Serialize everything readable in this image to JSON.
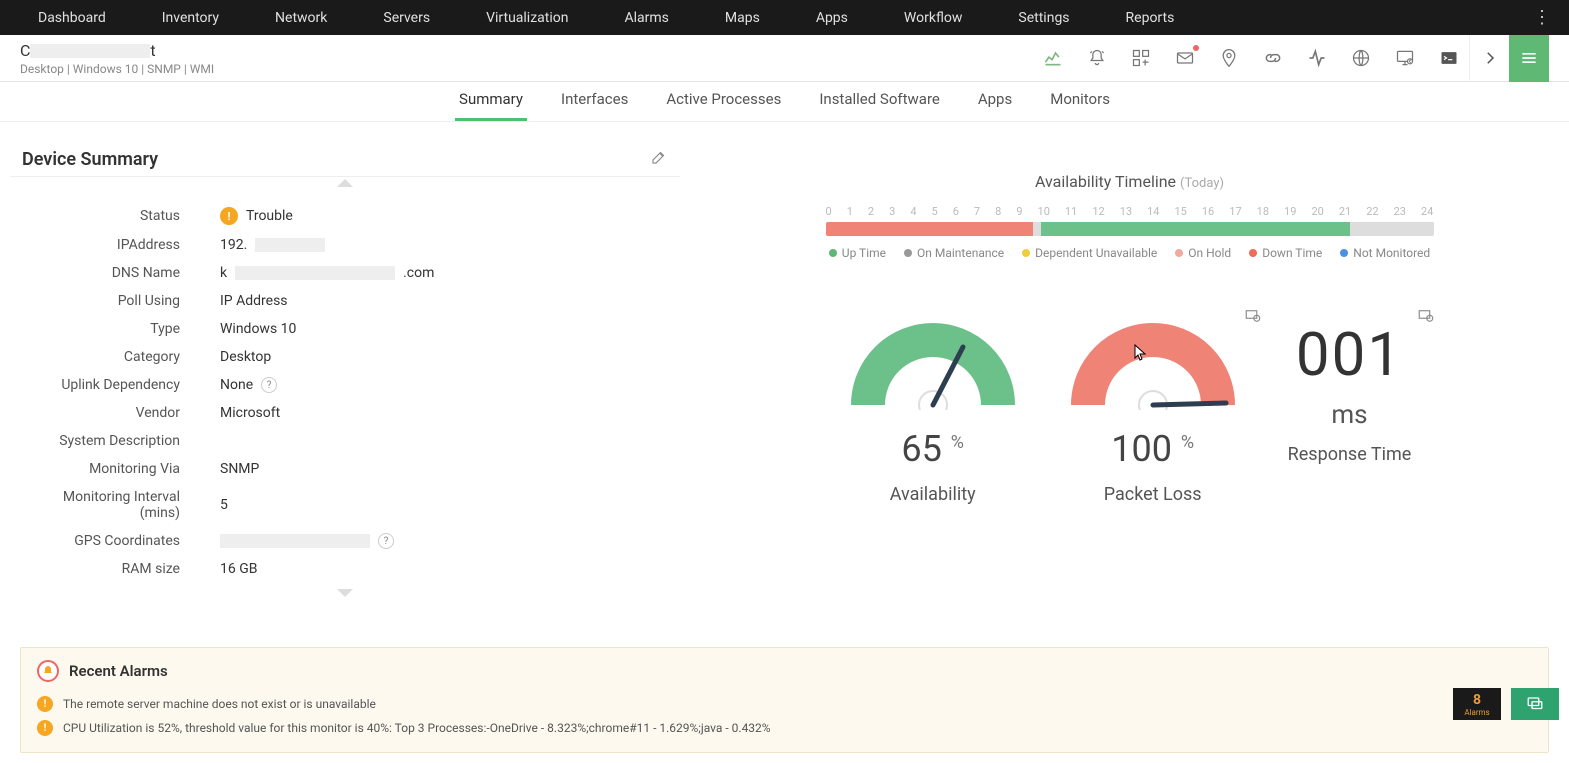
{
  "topnav": [
    "Dashboard",
    "Inventory",
    "Network",
    "Servers",
    "Virtualization",
    "Alarms",
    "Maps",
    "Apps",
    "Workflow",
    "Settings",
    "Reports"
  ],
  "device": {
    "name_prefix": "C",
    "name_suffix": "t",
    "meta": "Desktop  | Windows 10  | SNMP  | WMI"
  },
  "tabs": [
    "Summary",
    "Interfaces",
    "Active Processes",
    "Installed Software",
    "Apps",
    "Monitors"
  ],
  "active_tab": "Summary",
  "summary_title": "Device Summary",
  "props": {
    "status_label": "Status",
    "status_value": "Trouble",
    "ip_label": "IPAddress",
    "ip_value_prefix": "192.",
    "dns_label": "DNS Name",
    "dns_prefix": "k",
    "dns_suffix": ".com",
    "poll_label": "Poll Using",
    "poll_value": "IP Address",
    "type_label": "Type",
    "type_value": "Windows 10",
    "category_label": "Category",
    "category_value": "Desktop",
    "uplink_label": "Uplink Dependency",
    "uplink_value": "None",
    "vendor_label": "Vendor",
    "vendor_value": "Microsoft",
    "sysdesc_label": "System Description",
    "monvia_label": "Monitoring Via",
    "monvia_value": "SNMP",
    "moninterval_label": "Monitoring Interval (mins)",
    "moninterval_value": "5",
    "gps_label": "GPS Coordinates",
    "ram_label": "RAM size",
    "ram_value": "16 GB"
  },
  "timeline": {
    "title": "Availability Timeline",
    "subtitle": "(Today)",
    "hours": [
      "0",
      "1",
      "2",
      "3",
      "4",
      "5",
      "6",
      "7",
      "8",
      "9",
      "10",
      "11",
      "12",
      "13",
      "14",
      "15",
      "16",
      "17",
      "18",
      "19",
      "20",
      "21",
      "22",
      "23",
      "24"
    ],
    "legend": {
      "up": "Up Time",
      "maint": "On Maintenance",
      "dep": "Dependent Unavailable",
      "hold": "On Hold",
      "down": "Down Time",
      "nm": "Not Monitored"
    },
    "legend_colors": {
      "up": "#5db873",
      "maint": "#999",
      "dep": "#f0cd3a",
      "hold": "#f4a9a0",
      "down": "#ef6b5a",
      "nm": "#4a90e2"
    }
  },
  "gauges": {
    "availability": {
      "value": "65",
      "unit": "%",
      "label": "Availability"
    },
    "packetloss": {
      "value": "100",
      "unit": "%",
      "label": "Packet Loss"
    },
    "response": {
      "value": "001",
      "unit": "ms",
      "label": "Response Time"
    }
  },
  "alarms": {
    "title": "Recent Alarms",
    "items": [
      "The remote server machine does not exist or is unavailable",
      "CPU Utilization is 52%, threshold value for this monitor is 40%: Top 3 Processes:-OneDrive - 8.323%;chrome#11 - 1.629%;java - 0.432%"
    ]
  },
  "bottom": {
    "alarm_count": "8",
    "alarm_label": "Alarms"
  },
  "chart_data": {
    "timeline": {
      "type": "bar",
      "x_range": [
        0,
        24
      ],
      "segments": [
        {
          "state": "down",
          "from": 0,
          "to": 8.2
        },
        {
          "state": "unknown",
          "from": 8.2,
          "to": 8.4
        },
        {
          "state": "up",
          "from": 8.4,
          "to": 20.6
        },
        {
          "state": "not_monitored",
          "from": 20.6,
          "to": 24
        }
      ]
    },
    "gauges": [
      {
        "name": "Availability",
        "type": "gauge",
        "value": 65,
        "unit": "%",
        "range": [
          0,
          100
        ],
        "color": "#6cc18a"
      },
      {
        "name": "Packet Loss",
        "type": "gauge",
        "value": 100,
        "unit": "%",
        "range": [
          0,
          100
        ],
        "color": "#ef8376"
      },
      {
        "name": "Response Time",
        "type": "numeric",
        "value": 1,
        "unit": "ms"
      }
    ]
  }
}
